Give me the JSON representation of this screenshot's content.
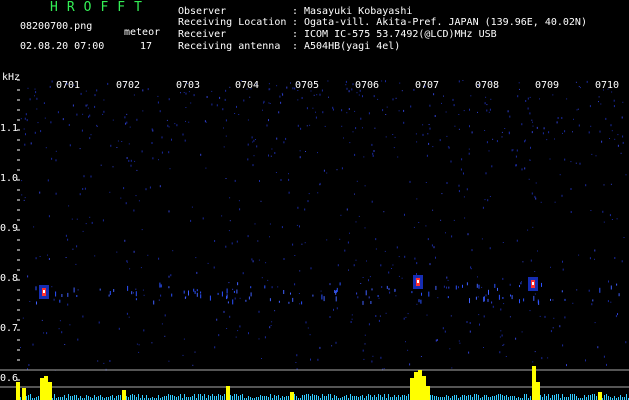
{
  "header": {
    "title": "HROFFT",
    "filename": "08200700.png",
    "timestamp": "02.08.20 07:00",
    "meteor_label": "meteor",
    "meteor_count": "17"
  },
  "info": [
    {
      "label": "Observer",
      "value": "Masayuki Kobayashi"
    },
    {
      "label": "Receiving Location",
      "value": "Ogata-vill. Akita-Pref. JAPAN (139.96E, 40.02N)"
    },
    {
      "label": "Receiver",
      "value": "ICOM IC-575 53.7492(@LCD)MHz USB"
    },
    {
      "label": "Receiving antenna",
      "value": "A504HB(yagi 4el)"
    }
  ],
  "separator": ":",
  "axis": {
    "unit": "kHz",
    "y_labels": [
      "1.1",
      "1.0",
      "0.9",
      "0.8",
      "0.7",
      "0.6"
    ],
    "x_labels": [
      "0701",
      "0702",
      "0703",
      "0704",
      "0705",
      "0706",
      "0707",
      "0708",
      "0709",
      "0710"
    ]
  },
  "colors": {
    "background": "#000000",
    "title": "#33ee55",
    "text": "#ffffff",
    "noise": "#1a2aa0",
    "signal": "#ff3030",
    "level_bar": "#ffff00",
    "level_base": "#33ccff"
  }
}
